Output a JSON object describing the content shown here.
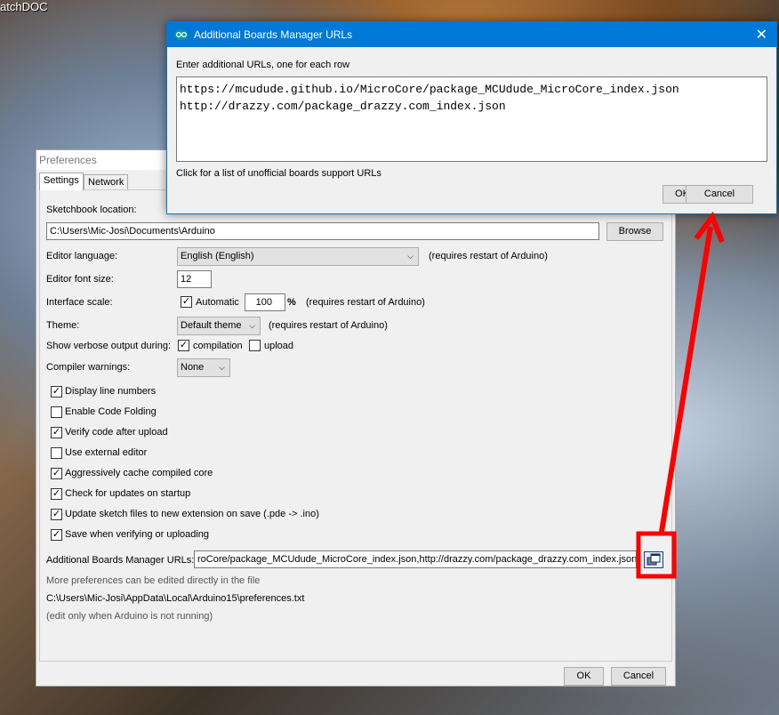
{
  "desktop": {
    "label": "atchDOC"
  },
  "prefs": {
    "title": "Preferences",
    "tabs": [
      "Settings",
      "Network"
    ],
    "sketchbook_label": "Sketchbook location:",
    "sketchbook_value": "C:\\Users\\Mic-Josi\\Documents\\Arduino",
    "browse": "Browse",
    "language_label": "Editor language:",
    "language_value": "English (English)",
    "restart_note": "(requires restart of Arduino)",
    "font_label": "Editor font size:",
    "font_value": "12",
    "scale_label": "Interface scale:",
    "scale_auto": "Automatic",
    "scale_value": "100",
    "scale_unit": "%",
    "theme_label": "Theme:",
    "theme_value": "Default theme",
    "verbose_label": "Show verbose output during:",
    "verbose_compilation": "compilation",
    "verbose_upload": "upload",
    "warnings_label": "Compiler warnings:",
    "warnings_value": "None",
    "checkboxes": [
      {
        "label": "Display line numbers",
        "checked": true
      },
      {
        "label": "Enable Code Folding",
        "checked": false
      },
      {
        "label": "Verify code after upload",
        "checked": true
      },
      {
        "label": "Use external editor",
        "checked": false
      },
      {
        "label": "Aggressively cache compiled core",
        "checked": true
      },
      {
        "label": "Check for updates on startup",
        "checked": true
      },
      {
        "label": "Update sketch files to new extension on save (.pde -> .ino)",
        "checked": true
      },
      {
        "label": "Save when verifying or uploading",
        "checked": true
      }
    ],
    "boards_label": "Additional Boards Manager URLs:",
    "boards_value": "roCore/package_MCUdude_MicroCore_index.json,http://drazzy.com/package_drazzy.com_index.json",
    "more_note": "More preferences can be edited directly in the file",
    "prefs_path": "C:\\Users\\Mic-Josi\\AppData\\Local\\Arduino15\\preferences.txt",
    "edit_note": "(edit only when Arduino is not running)",
    "ok": "OK",
    "cancel": "Cancel"
  },
  "dialog": {
    "title": "Additional Boards Manager URLs",
    "instruction": "Enter additional URLs, one for each row",
    "urls": "https://mcudude.github.io/MicroCore/package_MCUdude_MicroCore_index.json\nhttp://drazzy.com/package_drazzy.com_index.json",
    "link": "Click for a list of unofficial boards support URLs",
    "ok": "OK",
    "cancel": "Cancel"
  },
  "colors": {
    "accent": "#0078d7",
    "annotation": "#ff0000"
  }
}
